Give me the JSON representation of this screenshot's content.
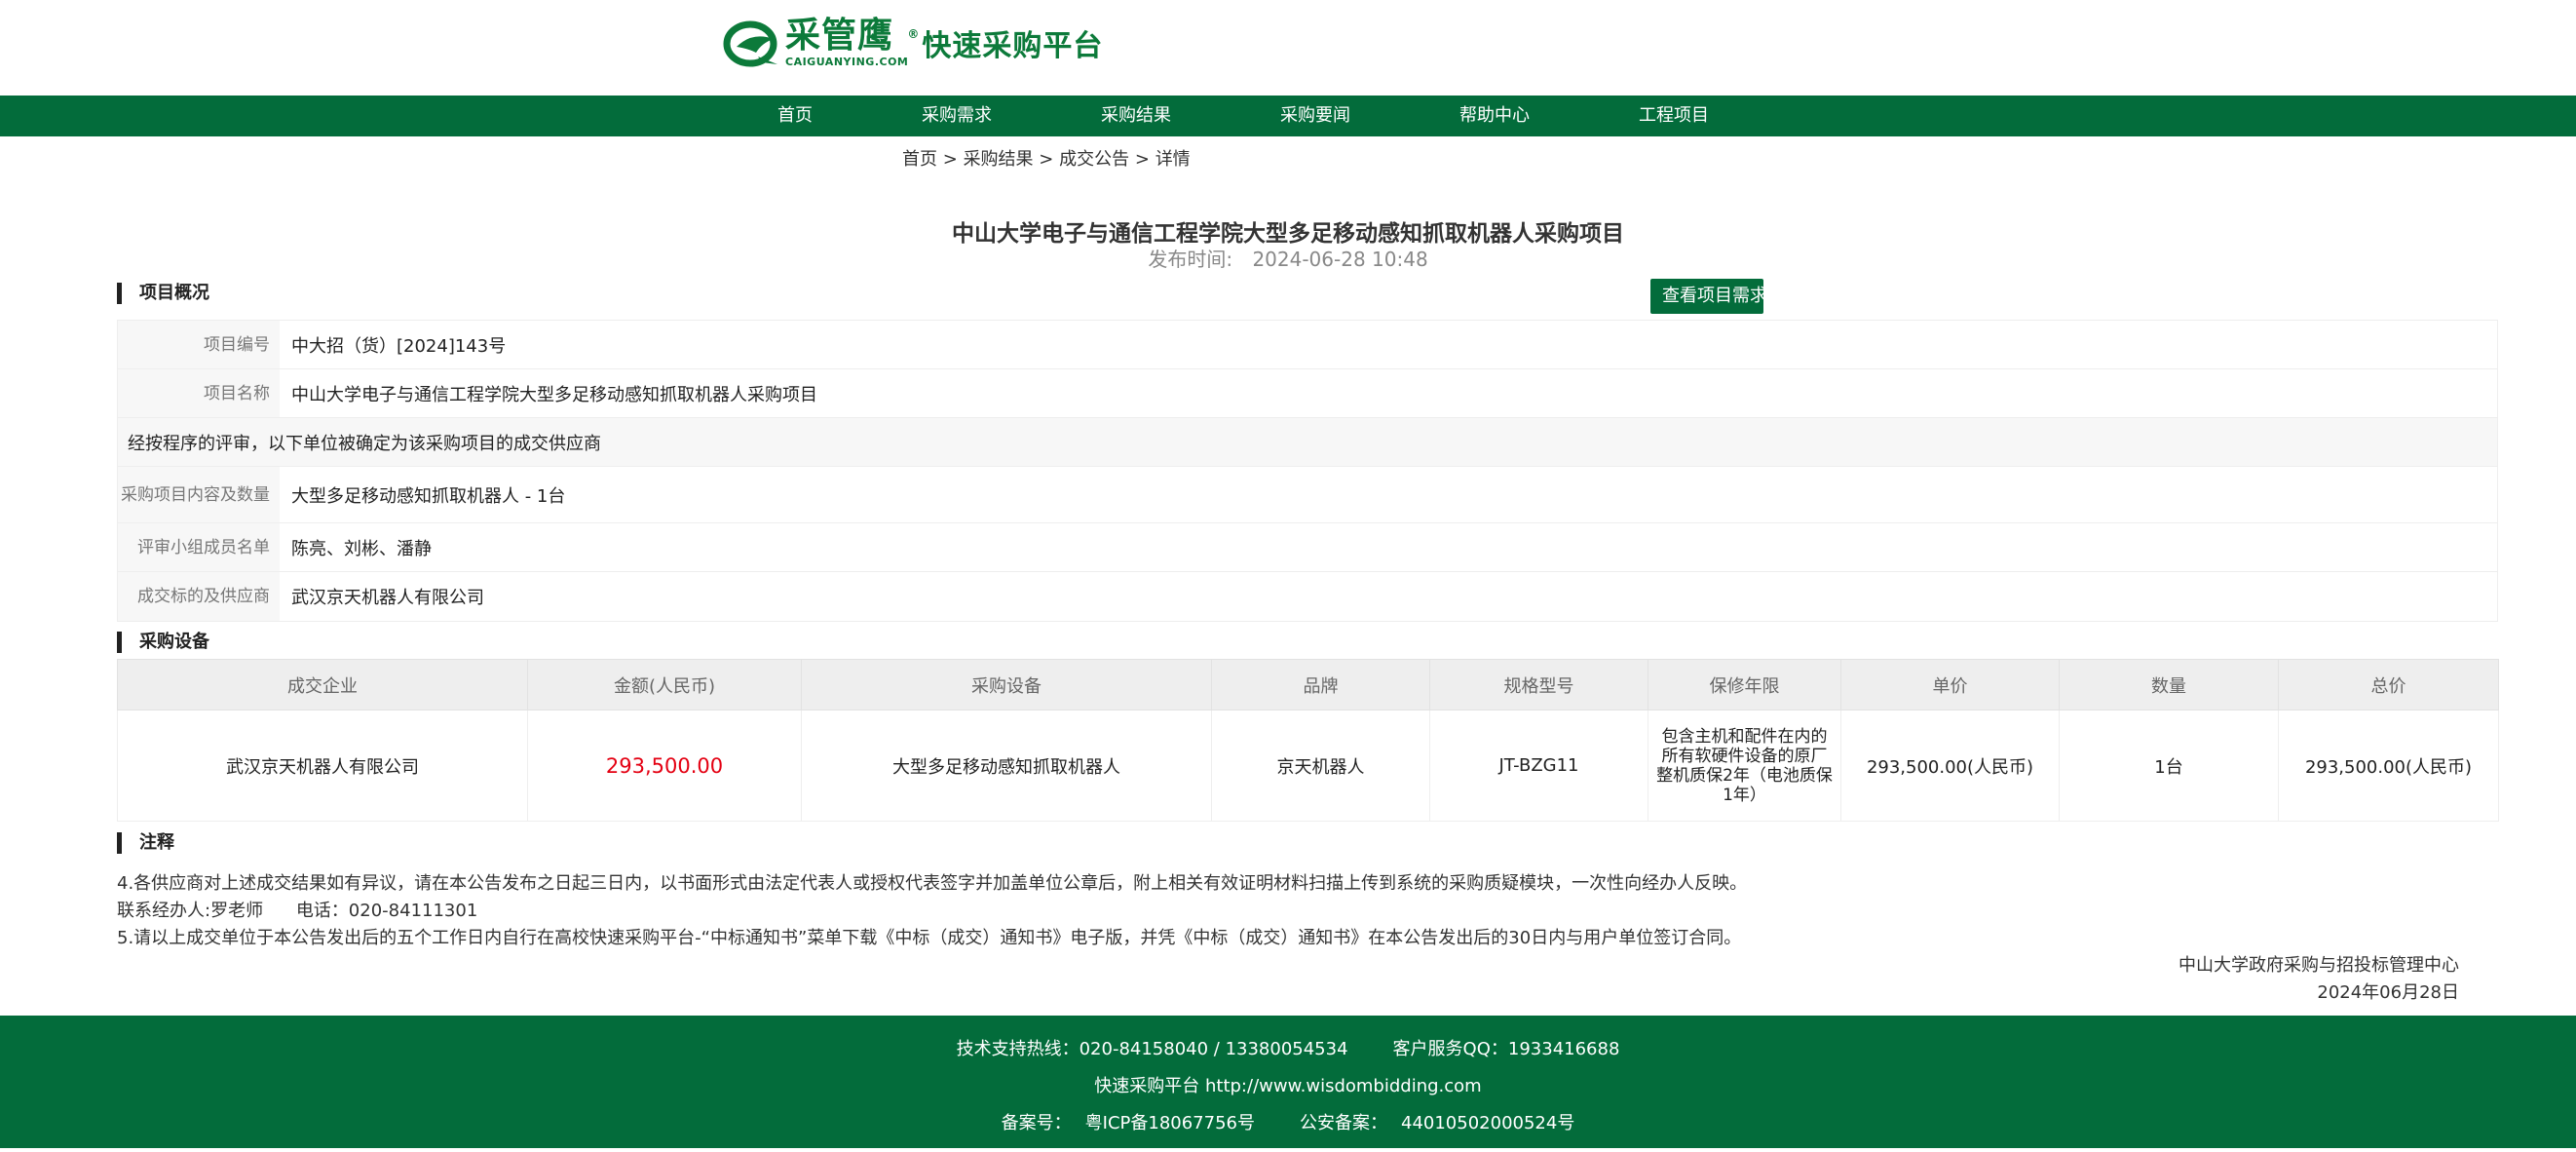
{
  "header": {
    "brand_cn": "采管鹰",
    "brand_mark": "®",
    "brand_en": "CAIGUANYING.COM",
    "platform": "快速采购平台"
  },
  "nav": {
    "items": [
      "首页",
      "采购需求",
      "采购结果",
      "采购要闻",
      "帮助中心",
      "工程项目"
    ]
  },
  "breadcrumb": {
    "items": [
      "首页",
      "采购结果",
      "成交公告",
      "详情"
    ],
    "separator": ">"
  },
  "title": "中山大学电子与通信工程学院大型多足移动感知抓取机器人采购项目",
  "publish": {
    "label": "发布时间:",
    "time": "2024-06-28 10:48"
  },
  "overview": {
    "heading": "项目概况",
    "view_button": "查看项目需求",
    "rows": [
      {
        "label": "项目编号",
        "value": "中大招（货）[2024]143号"
      },
      {
        "label": "项目名称",
        "value": "中山大学电子与通信工程学院大型多足移动感知抓取机器人采购项目"
      }
    ],
    "statement": "经按程序的评审，以下单位被确定为该采购项目的成交供应商",
    "rows2": [
      {
        "label": "采购项目内容及数量",
        "value": "大型多足移动感知抓取机器人 - 1台"
      },
      {
        "label": "评审小组成员名单",
        "value": "陈亮、刘彬、潘静"
      },
      {
        "label": "成交标的及供应商",
        "value": "武汉京天机器人有限公司"
      }
    ]
  },
  "equipment": {
    "heading": "采购设备",
    "columns": [
      "成交企业",
      "金额(人民币)",
      "采购设备",
      "品牌",
      "规格型号",
      "保修年限",
      "单价",
      "数量",
      "总价"
    ],
    "rows": [
      {
        "company": "武汉京天机器人有限公司",
        "amount": "293,500.00",
        "device": "大型多足移动感知抓取机器人",
        "brand": "京天机器人",
        "model": "JT-BZG11",
        "warranty": "包含主机和配件在内的所有软硬件设备的原厂整机质保2年（电池质保1年）",
        "unit_price": "293,500.00(人民币)",
        "quantity": "1台",
        "total": "293,500.00(人民币)"
      }
    ]
  },
  "notes": {
    "heading": "注释",
    "line1": "4.各供应商对上述成交结果如有异议，请在本公告发布之日起三日内，以书面形式由法定代表人或授权代表签字并加盖单位公章后，附上相关有效证明材料扫描上传到系统的采购质疑模块，一次性向经办人反映。",
    "contact_label": "联系经办人:罗老师",
    "phone": "电话：020-84111301",
    "line3": "5.请以上成交单位于本公告发出后的五个工作日内自行在高校快速采购平台-“中标通知书”菜单下载《中标（成交）通知书》电子版，并凭《中标（成交）通知书》在本公告发出后的30日内与用户单位签订合同。",
    "signer": "中山大学政府采购与招投标管理中心",
    "date": "2024年06月28日"
  },
  "footer": {
    "support": "技术支持热线：020-84158040 / 13380054534",
    "qq": "客户服务QQ：1933416688",
    "site": "快速采购平台 http://www.wisdombidding.com",
    "icp_label": "备案号：",
    "icp": "粤ICP备18067756号",
    "police_label": "公安备案：",
    "police": "44010502000524号"
  },
  "colors": {
    "brand_green": "#036c3b",
    "amount_red": "#e40012"
  }
}
